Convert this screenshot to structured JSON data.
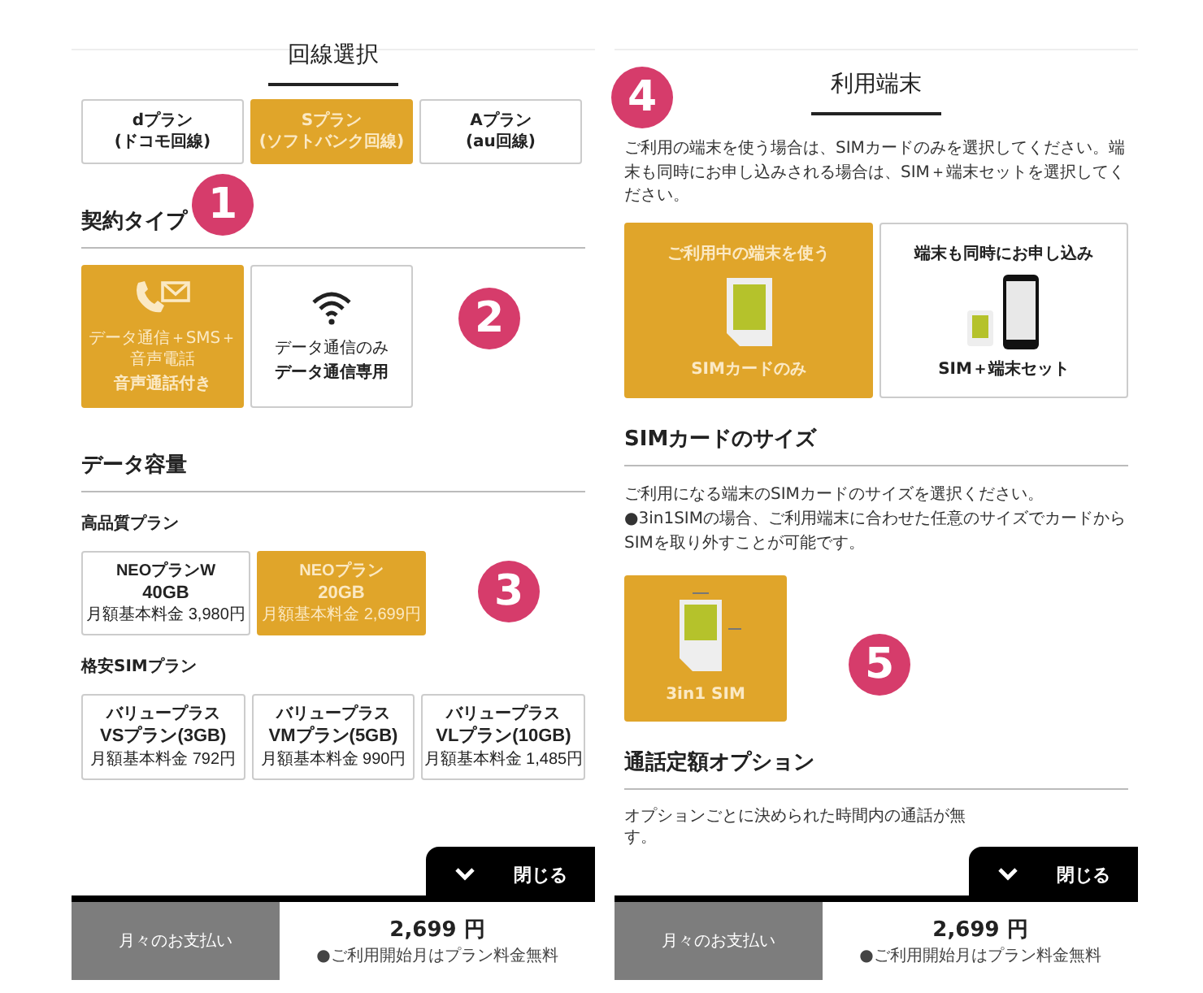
{
  "left_screen": {
    "title": "回線選択",
    "line_badge": "1",
    "line_options": [
      {
        "name": "dプラン",
        "carrier": "(ドコモ回線)",
        "selected": false
      },
      {
        "name": "Sプラン",
        "carrier": "(ソフトバンク回線)",
        "selected": true
      },
      {
        "name": "Aプラン",
        "carrier": "(au回線)",
        "selected": false
      }
    ],
    "contract_type": {
      "heading": "契約タイプ",
      "badge": "2",
      "options": [
        {
          "kind": "voice",
          "desc": "データ通信＋SMS＋音声電話",
          "label": "音声通話付き",
          "selected": true
        },
        {
          "kind": "data",
          "desc": "データ通信のみ",
          "label": "データ通信専用",
          "selected": false
        }
      ]
    },
    "data_capacity": {
      "heading": "データ容量",
      "badge": "3",
      "groups": [
        {
          "label": "高品質プラン",
          "plans": [
            {
              "series": "NEOプランW",
              "name": "40GB",
              "price": "月額基本料金 3,980円",
              "selected": false
            },
            {
              "series": "NEOプラン",
              "name": "20GB",
              "price": "月額基本料金 2,699円",
              "selected": true
            }
          ]
        },
        {
          "label": "格安SIMプラン",
          "plans": [
            {
              "series": "バリュープラス",
              "name": "VSプラン(3GB)",
              "price": "月額基本料金 792円",
              "selected": false
            },
            {
              "series": "バリュープラス",
              "name": "VMプラン(5GB)",
              "price": "月額基本料金 990円",
              "selected": false
            },
            {
              "series": "バリュープラス",
              "name": "VLプラン(10GB)",
              "price": "月額基本料金 1,485円",
              "selected": false
            }
          ]
        }
      ]
    },
    "close_button": "閉じる",
    "footer": {
      "label": "月々のお支払い",
      "amount": "2,699 円",
      "note": "●ご利用開始月はプラン料金無料"
    }
  },
  "right_screen": {
    "title": "利用端末",
    "badge": "4",
    "intro": "ご利用の端末を使う場合は、SIMカードのみを選択してください。端末も同時にお申し込みされる場合は、SIM＋端末セットを選択してください。",
    "device_options": [
      {
        "kind": "sim",
        "caption": "ご利用中の端末を使う",
        "label": "SIMカードのみ",
        "selected": true
      },
      {
        "kind": "sim_phone",
        "caption": "端末も同時にお申し込み",
        "label": "SIM＋端末セット",
        "selected": false
      }
    ],
    "sim_size": {
      "heading": "SIMカードのサイズ",
      "notes": [
        "ご利用になる端末のSIMカードのサイズを選択ください。",
        "●3in1SIMの場合、ご利用端末に合わせた任意のサイズでカードからSIMを取り外すことが可能です。"
      ],
      "badge": "5",
      "options": [
        {
          "label": "3in1 SIM",
          "selected": true
        }
      ]
    },
    "call_option": {
      "heading": "通話定額オプション",
      "lines": [
        "オプションごとに決められた時間内の通話が無",
        "す。"
      ]
    },
    "close_button": "閉じる",
    "footer": {
      "label": "月々のお支払い",
      "amount": "2,699 円",
      "note": "●ご利用開始月はプラン料金無料"
    }
  }
}
